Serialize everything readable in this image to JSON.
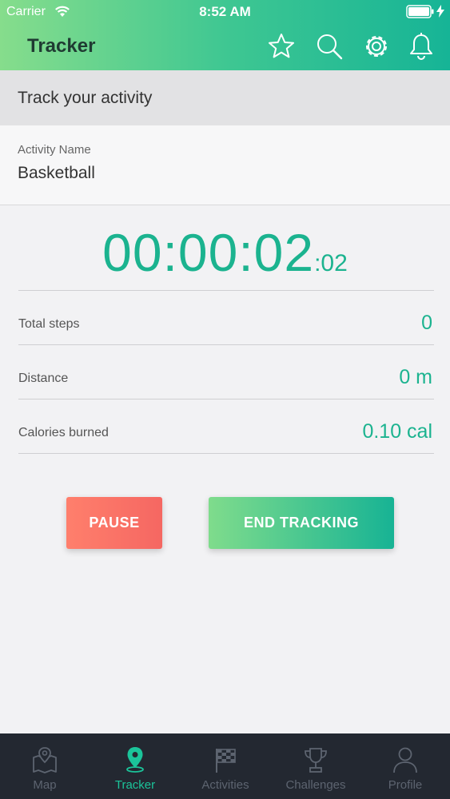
{
  "status_bar": {
    "carrier": "Carrier",
    "time": "8:52 AM"
  },
  "nav": {
    "title": "Tracker",
    "icons": [
      "star-icon",
      "search-icon",
      "gear-icon",
      "bell-icon"
    ]
  },
  "section": {
    "title": "Track your activity"
  },
  "activity": {
    "label": "Activity Name",
    "value": "Basketball"
  },
  "timer": {
    "main": "00:00:02",
    "fraction": ":02"
  },
  "stats": [
    {
      "label": "Total steps",
      "value": "0"
    },
    {
      "label": "Distance",
      "value": "0 m"
    },
    {
      "label": "Calories burned",
      "value": "0.10 cal"
    }
  ],
  "buttons": {
    "pause": "PAUSE",
    "end": "END TRACKING"
  },
  "tabs": [
    {
      "label": "Map",
      "icon": "map-pin-icon",
      "active": false
    },
    {
      "label": "Tracker",
      "icon": "location-pin-icon",
      "active": true
    },
    {
      "label": "Activities",
      "icon": "checkered-flag-icon",
      "active": false
    },
    {
      "label": "Challenges",
      "icon": "trophy-icon",
      "active": false
    },
    {
      "label": "Profile",
      "icon": "user-icon",
      "active": false
    }
  ],
  "colors": {
    "accent": "#1bb38f",
    "pause": "#f56762",
    "tabbar": "#232831",
    "tab_active": "#1bc49a"
  }
}
